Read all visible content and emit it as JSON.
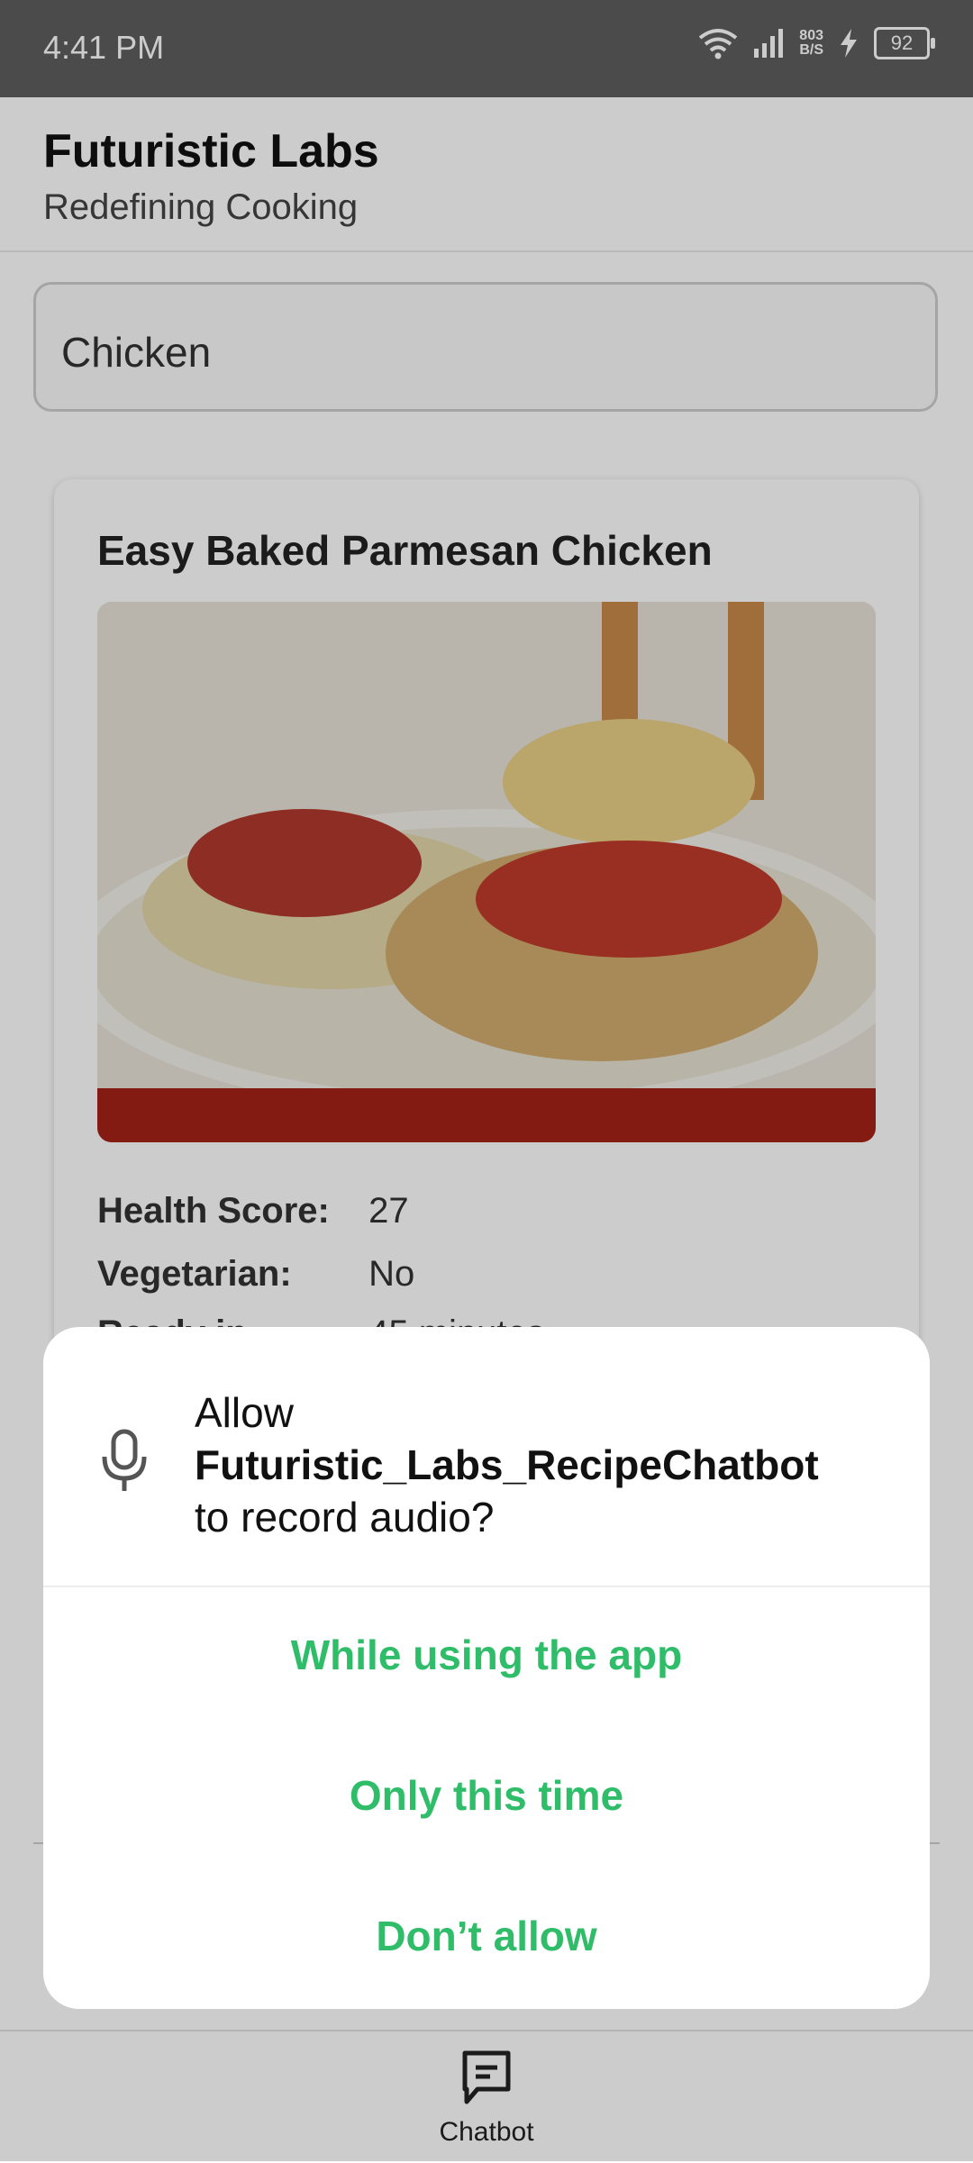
{
  "status_bar": {
    "time": "4:41 PM",
    "net_speed_value": "803",
    "net_speed_unit": "B/S",
    "battery": "92",
    "icons": [
      "wifi-icon",
      "signal-icon",
      "charging-icon",
      "battery-icon"
    ]
  },
  "header": {
    "title": "Futuristic Labs",
    "subtitle": "Redefining Cooking"
  },
  "search": {
    "value": "Chicken"
  },
  "recipe": {
    "title": "Easy Baked Parmesan Chicken",
    "health_score_label": "Health Score:",
    "health_score": "27",
    "vegetarian_label": "Vegetarian:",
    "vegetarian": "No",
    "ready_in_label": "Ready in:",
    "ready_in": "45 minutes"
  },
  "dialog": {
    "prefix": "Allow",
    "app_name": "Futuristic_Labs_RecipeChatbot",
    "suffix": "to record audio?",
    "buttons": {
      "while_using": "While using the app",
      "only_this_time": "Only this time",
      "dont_allow": "Don’t allow"
    },
    "accent_color": "#2fbd6a"
  },
  "bottom_nav": {
    "chatbot_label": "Chatbot"
  }
}
